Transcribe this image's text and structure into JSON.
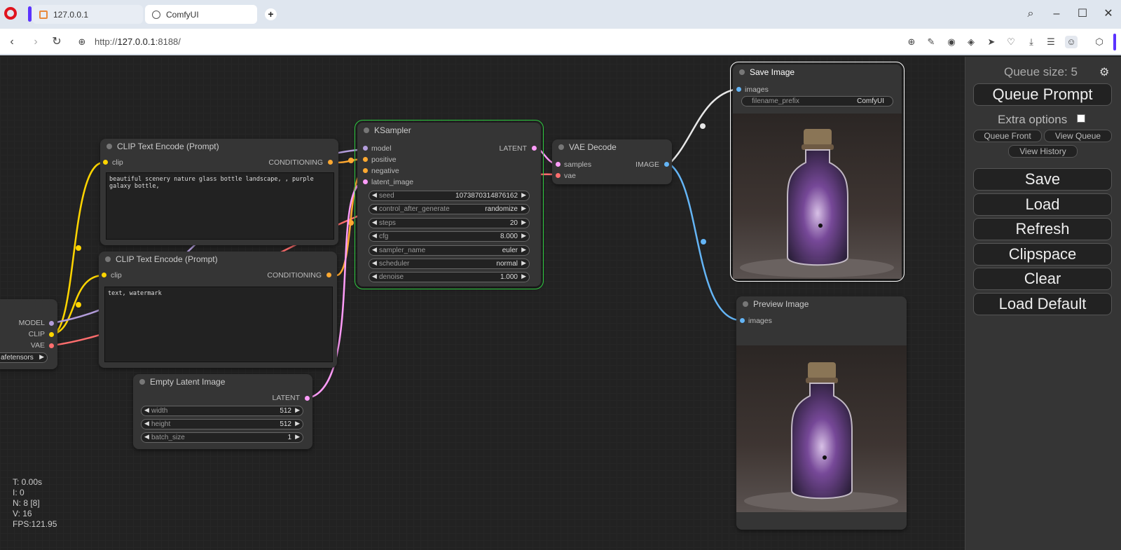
{
  "browser": {
    "tabs": [
      {
        "label": "127.0.0.1"
      },
      {
        "label": "ComfyUI"
      }
    ],
    "url_prefix": "http://",
    "url_host": "127.0.0.1",
    "url_port": ":8188/"
  },
  "nodes": {
    "clip_pos": {
      "title": "CLIP Text Encode (Prompt)",
      "input": "clip",
      "output": "CONDITIONING",
      "text": "beautiful scenery nature glass bottle landscape, , purple galaxy bottle,"
    },
    "clip_neg": {
      "title": "CLIP Text Encode (Prompt)",
      "input": "clip",
      "output": "CONDITIONING",
      "text": "text, watermark"
    },
    "checkpoint": {
      "out_model": "MODEL",
      "out_clip": "CLIP",
      "out_vae": "VAE",
      "widget_value": "afetensors"
    },
    "ksampler": {
      "title": "KSampler",
      "inputs": [
        "model",
        "positive",
        "negative",
        "latent_image"
      ],
      "output": "LATENT",
      "widgets": [
        {
          "label": "seed",
          "value": "1073870314876162"
        },
        {
          "label": "control_after_generate",
          "value": "randomize"
        },
        {
          "label": "steps",
          "value": "20"
        },
        {
          "label": "cfg",
          "value": "8.000"
        },
        {
          "label": "sampler_name",
          "value": "euler"
        },
        {
          "label": "scheduler",
          "value": "normal"
        },
        {
          "label": "denoise",
          "value": "1.000"
        }
      ]
    },
    "vae_decode": {
      "title": "VAE Decode",
      "inputs": [
        "samples",
        "vae"
      ],
      "output": "IMAGE"
    },
    "save_image": {
      "title": "Save Image",
      "input": "images",
      "widget_label": "filename_prefix",
      "widget_value": "ComfyUI"
    },
    "preview_image": {
      "title": "Preview Image",
      "input": "images"
    },
    "empty_latent": {
      "title": "Empty Latent Image",
      "output": "LATENT",
      "widgets": [
        {
          "label": "width",
          "value": "512"
        },
        {
          "label": "height",
          "value": "512"
        },
        {
          "label": "batch_size",
          "value": "1"
        }
      ]
    }
  },
  "stats": {
    "t": "T: 0.00s",
    "i": "I: 0",
    "n": "N: 8 [8]",
    "v": "V: 16",
    "fps": "FPS:121.95"
  },
  "panel": {
    "queue_size": "Queue size: 5",
    "queue_prompt": "Queue Prompt",
    "extra_options": "Extra options",
    "queue_front": "Queue Front",
    "view_queue": "View Queue",
    "view_history": "View History",
    "save": "Save",
    "load": "Load",
    "refresh": "Refresh",
    "clipspace": "Clipspace",
    "clear": "Clear",
    "load_default": "Load Default"
  },
  "colors": {
    "clip": "#ffd500",
    "conditioning": "#ffa931",
    "model": "#b39ddb",
    "latent": "#ff9cf9",
    "vae": "#ff6e6e",
    "image": "#64b5f6",
    "selected_outline": "#2ecc40"
  }
}
